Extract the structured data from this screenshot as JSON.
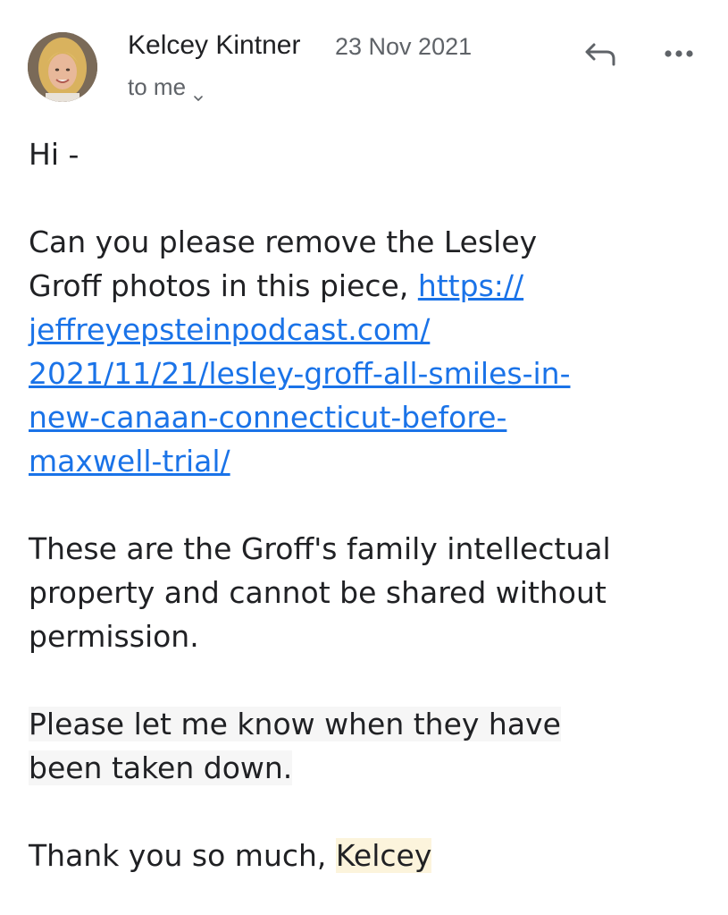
{
  "header": {
    "sender": "Kelcey Kintner",
    "date": "23 Nov 2021",
    "recipient": "to me",
    "icons": {
      "avatar": "sender-avatar-photo",
      "chevron": "chevron-down-icon",
      "reply": "reply-icon",
      "more": "more-horizontal-icon"
    }
  },
  "body": {
    "greeting": "Hi -",
    "request_line_1": "Can you please remove the Lesley",
    "request_line_2": "Groff photos in this piece, ",
    "link_1": "https://",
    "link_2": "jeffreyepsteinpodcast.com/",
    "link_3": "2021/11/21/lesley-groff-all-smiles-in-",
    "link_4": "new-canaan-connecticut-before-",
    "link_5": "maxwell-trial/",
    "ip_line_1": "These are the Groff's family intellectual",
    "ip_line_2": "property and cannot be shared without",
    "ip_line_3": "permission.",
    "followup_line_1": "Please let me know when they have",
    "followup_line_2": "been taken down.",
    "closing": "Thank you so much, ",
    "signature": "Kelcey"
  },
  "colors": {
    "link": "#1a73e8",
    "text": "#202124",
    "muted": "#5f6368",
    "signature_highlight": "#fcf4dc"
  }
}
